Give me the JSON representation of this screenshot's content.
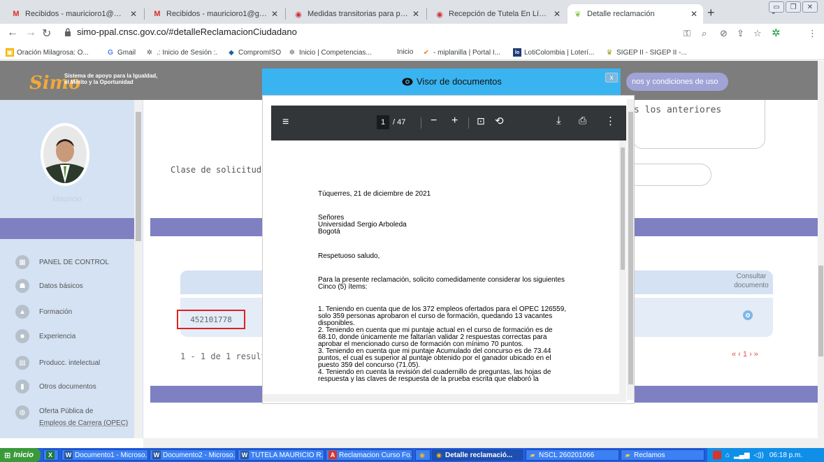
{
  "browser": {
    "tabs": [
      {
        "icon": "gmail-icon",
        "title": "Recibidos - mauriciorо1@misena..."
      },
      {
        "icon": "gmail-icon",
        "title": "Recibidos - mauricioro1@gmail.co"
      },
      {
        "icon": "shield-icon",
        "title": "Medidas transitorias para present"
      },
      {
        "icon": "shield-icon",
        "title": "Recepción de Tutela En Línea"
      },
      {
        "icon": "leaf-icon",
        "title": "Detalle reclamación"
      }
    ],
    "url": "simo-ppal.cnsc.gov.co/#detalleReclamacionCiudadano",
    "bookmarks": [
      "Oración Milagrosa: O...",
      "Gmail",
      ".: Inicio de Sesión :.",
      "CompromISO",
      "Inicio | Competencias...",
      "Inicio",
      "- miplanilla | Portal I...",
      "LotiColombia | Loterí...",
      "SIGEP II - SIGEP II -..."
    ]
  },
  "header": {
    "logo": "Simo",
    "logo_sub_line1": "Sistema de apoyo para la Igualdad,",
    "logo_sub_line2": "el Mérito y la Oportunidad",
    "terms": "nos y condiciones de uso"
  },
  "sidebar": {
    "username": "Mauricio",
    "items": [
      {
        "label": "PANEL DE CONTROL",
        "icon": "dashboard-icon"
      },
      {
        "label": "Datos básicos",
        "icon": "people-icon"
      },
      {
        "label": "Formación",
        "icon": "graduation-icon"
      },
      {
        "label": "Experiencia",
        "icon": "briefcase-icon"
      },
      {
        "label": "Producc. intelectual",
        "icon": "book-icon"
      },
      {
        "label": "Otros documentos",
        "icon": "document-icon"
      },
      {
        "label": "Oferta Pública de",
        "label2": "Empleos de Carrera (OPEC)",
        "icon": "globe-icon"
      }
    ]
  },
  "main": {
    "clase_label": "Clase de solicitud",
    "textarea_fragment": "s los anteriores",
    "table": {
      "col_consultar": "Consultar documento",
      "row_id": "452101778"
    },
    "results": "1 - 1 de 1 resultados",
    "pager": "« ‹ 1 › »"
  },
  "modal": {
    "title": "Visor de documentos",
    "close": "x",
    "pdf": {
      "page_current": "1",
      "page_total": "/ 47",
      "lines": [
        "Túquerres, 21 de diciembre de 2021",
        "Señores",
        "Universidad Sergio Arboleda",
        "Bogotá",
        "Respetuoso saludo,",
        "Para la presente reclamación, solicito comedidamente considerar los siguientes",
        "Cinco (5) ítems:",
        "1.  Teniendo en cuenta que de los 372 empleos ofertados para el OPEC 126559,",
        "     solo 359 personas aprobaron el curso de formación, quedando 13 vacantes",
        "     disponibles.",
        "2.  Teniendo en cuenta que mi puntaje actual en el curso de formación es de",
        "     68.10, donde únicamente me faltarían validar 2 respuestas correctas para",
        "     aprobar el mencionado curso de formación con mínimo 70 puntos.",
        "3.  Teniendo en cuenta que mi puntaje Acumulado del concurso es de 73.44",
        "     puntos, el cual es superior al puntaje obtenido por el ganador ubicado en el",
        "     puesto 359 del concurso (71.05).",
        "4.  Teniendo en cuenta la revisión del cuadernillo de preguntas, las hojas de",
        "     respuesta y las claves de respuesta de la prueba escrita que elaboró la"
      ]
    }
  },
  "taskbar": {
    "start": "Inicio",
    "items": [
      "Documento1 - Microso...",
      "Documento2 - Microso...",
      "TUTELA MAURICIO R...",
      "Reclamacion Curso Fo...",
      "Detalle reclamació...",
      "NSCL 260201066",
      "Reclamos"
    ],
    "clock": "06:18 p.m."
  },
  "colors": {
    "accent_blue": "#3ab4f0",
    "band_purple": "#7e80c2",
    "sidebar_bg": "#d4e2f3",
    "highlight_red": "#e02020"
  }
}
